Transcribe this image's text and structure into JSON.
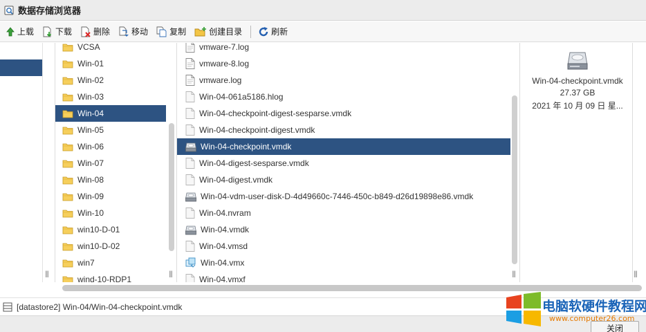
{
  "window": {
    "title": "数据存储浏览器",
    "title_icon": "datastore-browser-icon"
  },
  "toolbar": {
    "items": [
      {
        "label": "上载",
        "icon": "upload-arrow-icon"
      },
      {
        "label": "下载",
        "icon": "download-file-icon"
      },
      {
        "label": "删除",
        "icon": "delete-file-icon"
      },
      {
        "label": "移动",
        "icon": "move-file-icon"
      },
      {
        "label": "复制",
        "icon": "copy-file-icon"
      },
      {
        "label": "创建目录",
        "icon": "new-folder-icon"
      },
      {
        "label": "刷新",
        "icon": "refresh-icon"
      }
    ]
  },
  "folders": {
    "items": [
      "VCSA",
      "Win-01",
      "Win-02",
      "Win-03",
      "Win-04",
      "Win-05",
      "Win-06",
      "Win-07",
      "Win-08",
      "Win-09",
      "Win-10",
      "win10-D-01",
      "win10-D-02",
      "win7",
      "wind-10-RDP1"
    ],
    "selected": "Win-04"
  },
  "files": {
    "items": [
      {
        "name": "vmware-7.log",
        "icon": "document-icon"
      },
      {
        "name": "vmware-8.log",
        "icon": "document-icon"
      },
      {
        "name": "vmware.log",
        "icon": "document-icon"
      },
      {
        "name": "Win-04-061a5186.hlog",
        "icon": "blank-file-icon"
      },
      {
        "name": "Win-04-checkpoint-digest-sesparse.vmdk",
        "icon": "blank-file-icon"
      },
      {
        "name": "Win-04-checkpoint-digest.vmdk",
        "icon": "blank-file-icon"
      },
      {
        "name": "Win-04-checkpoint.vmdk",
        "icon": "disk-icon"
      },
      {
        "name": "Win-04-digest-sesparse.vmdk",
        "icon": "blank-file-icon"
      },
      {
        "name": "Win-04-digest.vmdk",
        "icon": "blank-file-icon"
      },
      {
        "name": "Win-04-vdm-user-disk-D-4d49660c-7446-450c-b849-d26d19898e86.vmdk",
        "icon": "disk-icon"
      },
      {
        "name": "Win-04.nvram",
        "icon": "blank-file-icon"
      },
      {
        "name": "Win-04.vmdk",
        "icon": "disk-icon"
      },
      {
        "name": "Win-04.vmsd",
        "icon": "blank-file-icon"
      },
      {
        "name": "Win-04.vmx",
        "icon": "vm-config-icon"
      },
      {
        "name": "Win-04.vmxf",
        "icon": "blank-file-icon"
      }
    ],
    "selected": "Win-04-checkpoint.vmdk"
  },
  "detail": {
    "icon": "disk-icon",
    "name": "Win-04-checkpoint.vmdk",
    "size": "27.37 GB",
    "date": "2021 年 10 月 09 日 星..."
  },
  "status": {
    "icon": "datastore-icon",
    "path": "[datastore2] Win-04/Win-04-checkpoint.vmdk"
  },
  "footer": {
    "close_label": "关闭"
  },
  "watermark": {
    "text": "电脑软硬件教程网",
    "url": "www.computer26.com",
    "logo": "windows-logo"
  },
  "colors": {
    "selection": "#2d5382",
    "watermark_text": "#1a64b8",
    "watermark_url": "#e57a00"
  }
}
